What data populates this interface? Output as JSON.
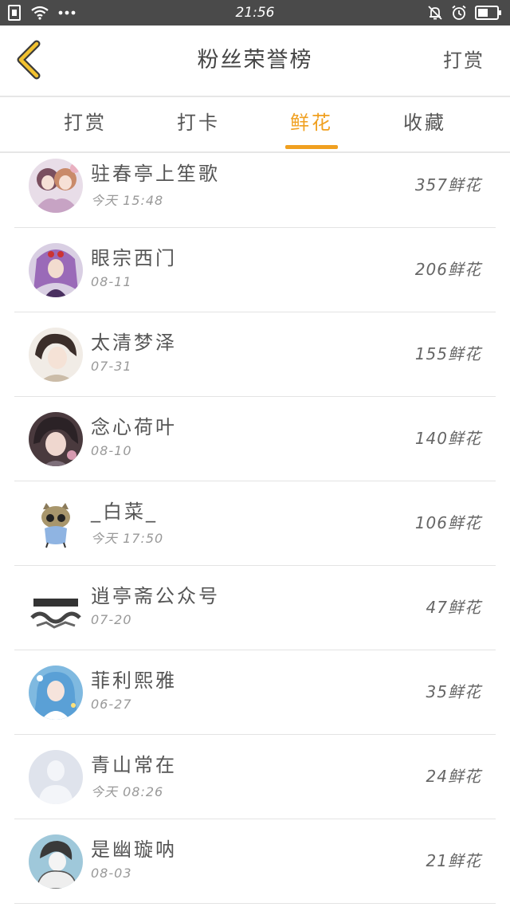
{
  "status_bar": {
    "time": "21:56",
    "left_icons": [
      "sim-icon",
      "wifi-icon",
      "more-dots-icon"
    ],
    "right_icons": [
      "mute-bell-icon",
      "alarm-icon",
      "battery-icon"
    ]
  },
  "header": {
    "back_icon": "chevron-left-icon",
    "title": "粉丝荣誉榜",
    "action_label": "打赏"
  },
  "tabs": [
    {
      "label": "打赏",
      "active": false
    },
    {
      "label": "打卡",
      "active": false
    },
    {
      "label": "鲜花",
      "active": true
    },
    {
      "label": "收藏",
      "active": false
    }
  ],
  "colors": {
    "accent": "#f0a020",
    "status_bar_bg": "#4a4a4a",
    "divider": "#e6e6e6"
  },
  "fans": [
    {
      "name": "驻春亭上笙歌",
      "time": "今天 15:48",
      "amount": "357鲜花",
      "avatar": "anime-girls-avatar"
    },
    {
      "name": "眼宗西门",
      "time": "08-11",
      "amount": "206鲜花",
      "avatar": "purple-anime-avatar"
    },
    {
      "name": "太清梦泽",
      "time": "07-31",
      "amount": "155鲜花",
      "avatar": "anime-boy-avatar"
    },
    {
      "name": "念心荷叶",
      "time": "08-10",
      "amount": "140鲜花",
      "avatar": "dark-anime-avatar"
    },
    {
      "name": "_白菜_",
      "time": "今天 17:50",
      "amount": "106鲜花",
      "avatar": "cat-glasses-avatar"
    },
    {
      "name": "逍亭斋公众号",
      "time": "07-20",
      "amount": "47鲜花",
      "avatar": "calligraphy-logo-avatar"
    },
    {
      "name": "菲利熙雅",
      "time": "06-27",
      "amount": "35鲜花",
      "avatar": "blue-anime-avatar"
    },
    {
      "name": "青山常在",
      "time": "今天 08:26",
      "amount": "24鲜花",
      "avatar": "default-person-avatar"
    },
    {
      "name": "是幽璇呐",
      "time": "08-03",
      "amount": "21鲜花",
      "avatar": "sketch-avatar"
    }
  ]
}
